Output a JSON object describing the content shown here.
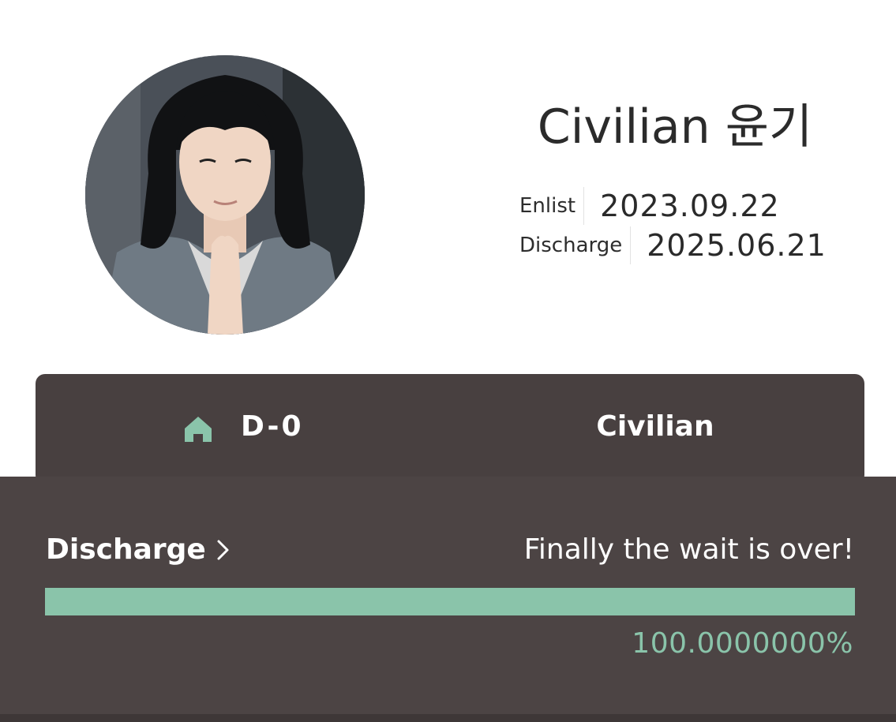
{
  "profile": {
    "name": "Civilian 윤기",
    "enlist_label": "Enlist",
    "enlist_date": "2023.09.22",
    "discharge_label": "Discharge",
    "discharge_date": "2025.06.21"
  },
  "status_bar": {
    "icon": "home-icon",
    "dday": "D-0",
    "status": "Civilian",
    "icon_color": "#8ac4aa",
    "background": "#484040"
  },
  "discharge_panel": {
    "title": "Discharge",
    "message": "Finally the wait is over!",
    "progress_fraction": 1.0,
    "percent_text": "100.0000000%",
    "accent_color": "#8ac4aa"
  }
}
